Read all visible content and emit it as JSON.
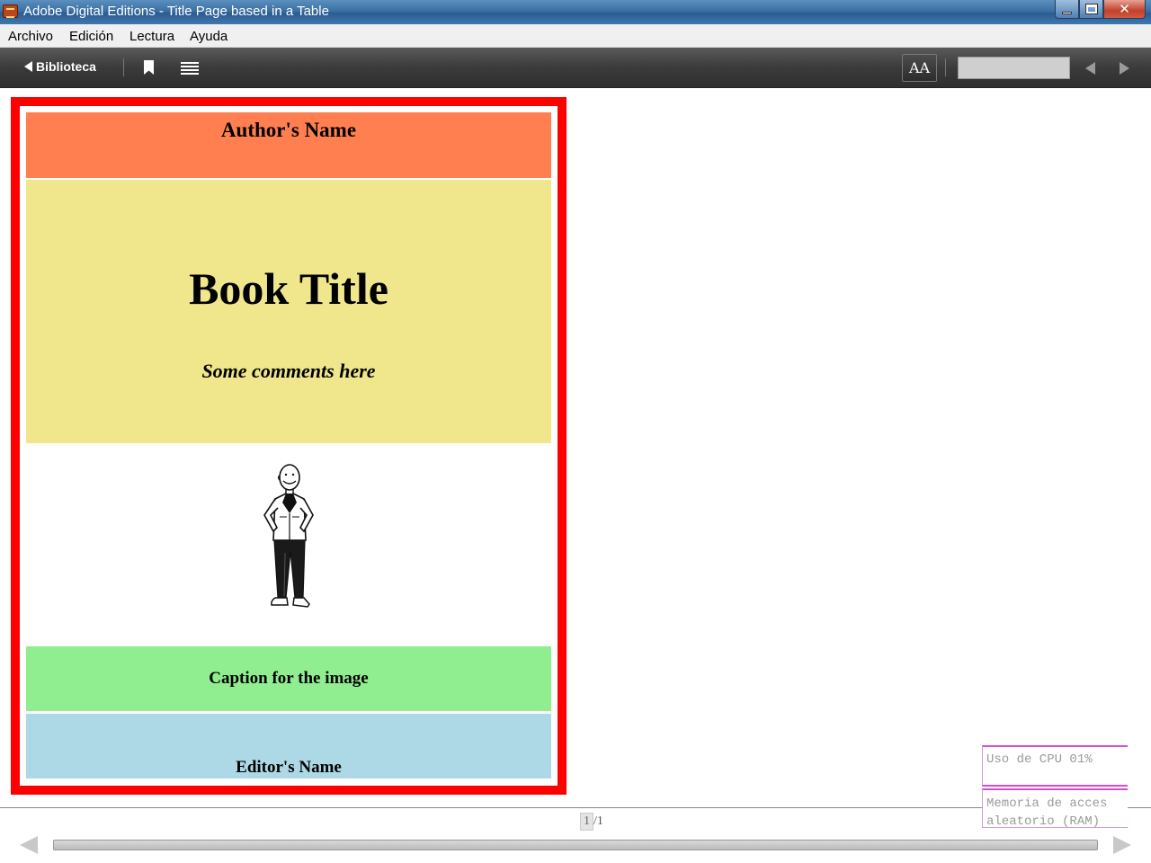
{
  "window": {
    "title": "Adobe Digital Editions - Title Page based in a Table",
    "close_glyph": "✕"
  },
  "menu": {
    "items": [
      "Archivo",
      "Edición",
      "Lectura",
      "Ayuda"
    ]
  },
  "toolbar": {
    "library_label": "Biblioteca",
    "font_label": "AA"
  },
  "book": {
    "author": "Author's Name",
    "title": "Book Title",
    "comments": "Some comments here",
    "caption": "Caption for the image",
    "editor": "Editor's Name"
  },
  "pager": {
    "current": "1",
    "separator": "/",
    "total": "1"
  },
  "gadget": {
    "cpu_label": "Uso de CPU 01%",
    "ram_label_line1": "Memoria de acces",
    "ram_label_line2": "aleatorio (RAM)"
  },
  "colors": {
    "frame": "#ff0000",
    "author_bg": "#ff7f50",
    "title_bg": "#f0e68c",
    "caption_bg": "#90ee90",
    "editor_bg": "#add8e6"
  }
}
